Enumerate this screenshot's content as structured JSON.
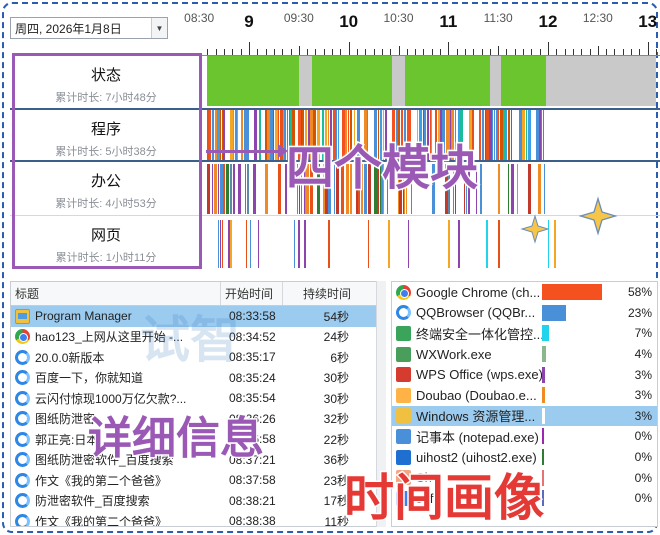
{
  "date_picker": {
    "value": "周四, 2026年1月8日"
  },
  "timeline": {
    "hour_labels": [
      "9",
      "10",
      "11",
      "12",
      "13"
    ],
    "half_labels": [
      "08:30",
      "09:30",
      "10:30",
      "11:30",
      "12:30"
    ]
  },
  "rows": [
    {
      "title": "状态",
      "sub": "累计时长: 7小时48分"
    },
    {
      "title": "程序",
      "sub": "累计时长: 5小时38分"
    },
    {
      "title": "办公",
      "sub": "累计时长: 4小时53分"
    },
    {
      "title": "网页",
      "sub": "累计时长: 1小时11分"
    }
  ],
  "status_segments": [
    {
      "start": "08:35",
      "end": "09:30",
      "state": "active"
    },
    {
      "start": "09:30",
      "end": "09:38",
      "state": "idle"
    },
    {
      "start": "09:38",
      "end": "10:26",
      "state": "active"
    },
    {
      "start": "10:26",
      "end": "10:34",
      "state": "idle"
    },
    {
      "start": "10:34",
      "end": "11:25",
      "state": "active"
    },
    {
      "start": "11:25",
      "end": "11:32",
      "state": "idle"
    },
    {
      "start": "11:32",
      "end": "11:59",
      "state": "active"
    },
    {
      "start": "11:59",
      "end": "13:05",
      "state": "idle"
    }
  ],
  "colors": {
    "active": "#6ac52f",
    "idle": "#c9c9c9",
    "program_palette": [
      "#f4511e",
      "#e8501a",
      "#4a90d9",
      "#ffffff",
      "#f08a24",
      "#3aa0e8",
      "#8e44ad",
      "#1abc9c",
      "#f5a623",
      "#d35400"
    ],
    "office_palette": [
      "#e8501a",
      "#4a90d9",
      "#8e44ad",
      "#ffffff",
      "#5d8aa8",
      "#f08a24",
      "#2e7d32",
      "#c0392b"
    ],
    "web_palette": [
      "#e8501a",
      "#22d3ee",
      "#8e44ad",
      "#4a90d9",
      "#f5a623"
    ],
    "accent_purple": "#9b59b6",
    "accent_red": "#e53935",
    "selection": "#9ccbf0"
  },
  "list": {
    "headers": {
      "title": "标题",
      "start": "开始时间",
      "duration": "持续时间"
    },
    "rows": [
      {
        "icon": "program-manager-icon",
        "title": "Program Manager",
        "start": "08:33:58",
        "duration": "54秒",
        "selected": true
      },
      {
        "icon": "chrome-icon",
        "title": "hao123_上网从这里开始 -...",
        "start": "08:34:52",
        "duration": "24秒",
        "selected": false
      },
      {
        "icon": "qqbrowser-icon",
        "title": "20.0.0新版本",
        "start": "08:35:17",
        "duration": "6秒",
        "selected": false
      },
      {
        "icon": "qqbrowser-icon",
        "title": "百度一下，你就知道",
        "start": "08:35:24",
        "duration": "30秒",
        "selected": false
      },
      {
        "icon": "qqbrowser-icon",
        "title": "云闪付惊现1000万亿欠款?...",
        "start": "08:35:54",
        "duration": "30秒",
        "selected": false
      },
      {
        "icon": "qqbrowser-icon",
        "title": "图纸防泄密",
        "start": "08:36:26",
        "duration": "32秒",
        "selected": false
      },
      {
        "icon": "qqbrowser-icon",
        "title": "郭正亮:日本",
        "start": "08:36:58",
        "duration": "22秒",
        "selected": false
      },
      {
        "icon": "qqbrowser-icon",
        "title": "图纸防泄密软件_百度搜索",
        "start": "08:37:21",
        "duration": "36秒",
        "selected": false
      },
      {
        "icon": "qqbrowser-icon",
        "title": "作文《我的第二个爸爸》",
        "start": "08:37:58",
        "duration": "23秒",
        "selected": false
      },
      {
        "icon": "qqbrowser-icon",
        "title": "防泄密软件_百度搜索",
        "start": "08:38:21",
        "duration": "17秒",
        "selected": false
      },
      {
        "icon": "qqbrowser-icon",
        "title": "作文《我的第二个爸爸》",
        "start": "08:38:38",
        "duration": "11秒",
        "selected": false
      }
    ]
  },
  "apps": [
    {
      "icon": "chrome-icon",
      "name": "Google Chrome (ch...",
      "pct": "58%",
      "value": 58,
      "color": "#f4511e",
      "selected": false
    },
    {
      "icon": "qqbrowser-icon",
      "name": "QQBrowser (QQBr...",
      "pct": "23%",
      "value": 23,
      "color": "#4a90d9",
      "selected": false
    },
    {
      "icon": "security-icon",
      "name": "终端安全一体化管控...",
      "pct": "7%",
      "value": 7,
      "color": "#22d3ee",
      "selected": false
    },
    {
      "icon": "wxwork-icon",
      "name": "WXWork.exe",
      "pct": "4%",
      "value": 4,
      "color": "#8ab88a",
      "selected": false
    },
    {
      "icon": "wps-icon",
      "name": "WPS Office (wps.exe)",
      "pct": "3%",
      "value": 3,
      "color": "#8e44ad",
      "selected": false
    },
    {
      "icon": "doubao-icon",
      "name": "Doubao (Doubao.e...",
      "pct": "3%",
      "value": 3,
      "color": "#f08a24",
      "selected": false
    },
    {
      "icon": "explorer-icon",
      "name": "Windows 资源管理...",
      "pct": "3%",
      "value": 3,
      "color": "#ffffff",
      "selected": true
    },
    {
      "icon": "notepad-icon",
      "name": "记事本 (notepad.exe)",
      "pct": "0%",
      "value": 0.4,
      "color": "#9c27b0",
      "selected": false
    },
    {
      "icon": "uihost-icon",
      "name": "uihost2 (uihost2.exe)",
      "pct": "0%",
      "value": 0.3,
      "color": "#2e7d32",
      "selected": false
    },
    {
      "icon": "app-icon",
      "name": "Sh",
      "pct": "0%",
      "value": 0.2,
      "color": "#e57373",
      "selected": false
    },
    {
      "icon": "safe-icon",
      "name": "safe",
      "pct": "0%",
      "value": 0.2,
      "color": "#5c6bc0",
      "selected": false
    }
  ],
  "overlays": {
    "modules": "四个模块",
    "detail": "详细信息",
    "profile": "时间画像",
    "watermark": "试智"
  }
}
